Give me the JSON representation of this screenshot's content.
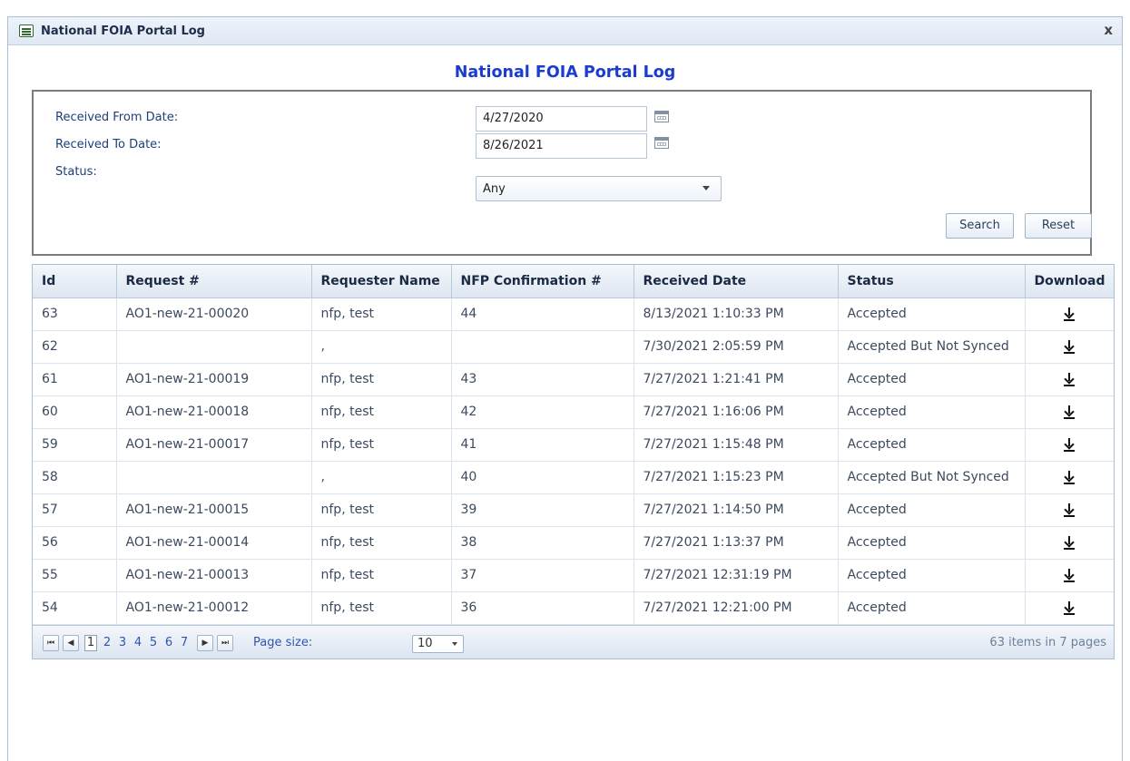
{
  "window": {
    "title": "National FOIA Portal Log",
    "close_glyph": "x"
  },
  "heading": "National FOIA Portal Log",
  "filters": {
    "from_label": "Received From Date:",
    "from_value": "4/27/2020",
    "to_label": "Received To Date:",
    "to_value": "8/26/2021",
    "status_label": "Status:",
    "status_value": "Any",
    "search_label": "Search",
    "reset_label": "Reset"
  },
  "grid": {
    "columns": [
      "Id",
      "Request #",
      "Requester Name",
      "NFP Confirmation #",
      "Received Date",
      "Status",
      "Download"
    ],
    "rows": [
      {
        "id": "63",
        "request": "AO1-new-21-00020",
        "requester": "nfp, test",
        "nfp": "44",
        "received": "8/13/2021 1:10:33 PM",
        "status": "Accepted"
      },
      {
        "id": "62",
        "request": "",
        "requester": ",",
        "nfp": "",
        "received": "7/30/2021 2:05:59 PM",
        "status": "Accepted But Not Synced"
      },
      {
        "id": "61",
        "request": "AO1-new-21-00019",
        "requester": "nfp, test",
        "nfp": "43",
        "received": "7/27/2021 1:21:41 PM",
        "status": "Accepted"
      },
      {
        "id": "60",
        "request": "AO1-new-21-00018",
        "requester": "nfp, test",
        "nfp": "42",
        "received": "7/27/2021 1:16:06 PM",
        "status": "Accepted"
      },
      {
        "id": "59",
        "request": "AO1-new-21-00017",
        "requester": "nfp, test",
        "nfp": "41",
        "received": "7/27/2021 1:15:48 PM",
        "status": "Accepted"
      },
      {
        "id": "58",
        "request": "",
        "requester": ",",
        "nfp": "40",
        "received": "7/27/2021 1:15:23 PM",
        "status": "Accepted But Not Synced"
      },
      {
        "id": "57",
        "request": "AO1-new-21-00015",
        "requester": "nfp, test",
        "nfp": "39",
        "received": "7/27/2021 1:14:50 PM",
        "status": "Accepted"
      },
      {
        "id": "56",
        "request": "AO1-new-21-00014",
        "requester": "nfp, test",
        "nfp": "38",
        "received": "7/27/2021 1:13:37 PM",
        "status": "Accepted"
      },
      {
        "id": "55",
        "request": "AO1-new-21-00013",
        "requester": "nfp, test",
        "nfp": "37",
        "received": "7/27/2021 12:31:19 PM",
        "status": "Accepted"
      },
      {
        "id": "54",
        "request": "AO1-new-21-00012",
        "requester": "nfp, test",
        "nfp": "36",
        "received": "7/27/2021 12:21:00 PM",
        "status": "Accepted"
      }
    ]
  },
  "pager": {
    "first_glyph": "⏮",
    "prev_glyph": "◀",
    "next_glyph": "▶",
    "last_glyph": "⏭",
    "pages": [
      "1",
      "2",
      "3",
      "4",
      "5",
      "6",
      "7"
    ],
    "current_page": "1",
    "page_size_label": "Page size:",
    "page_size_value": "10",
    "items_info": "63 items in 7 pages"
  }
}
